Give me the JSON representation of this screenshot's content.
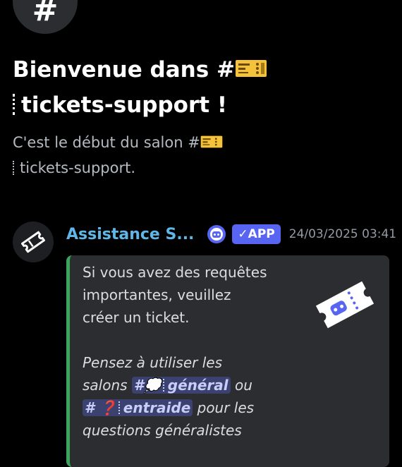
{
  "channel": {
    "hash_symbol": "#",
    "welcome_prefix": "Bienvenue dans #",
    "channel_name": "tickets-support",
    "welcome_suffix": " !",
    "subtitle_prefix": "C'est le début du salon #",
    "subtitle_suffix": "."
  },
  "message": {
    "author": "Assistance S...",
    "badge": "APP",
    "badge_check": "✓",
    "timestamp": "24/03/2025 03:41",
    "embed": {
      "accent_color": "#3ba55c",
      "line1": "Si vous avez des requêtes",
      "line2": "importantes, veuillez",
      "line3": "créer un ticket.",
      "line4": "Pensez à utiliser les",
      "line5_prefix": "salons ",
      "mention1_hash": "#",
      "mention1_emoji": "💭",
      "mention1_name": "général",
      "line5_suffix": " ou",
      "mention2_hash": "#",
      "mention2_emoji": "❓",
      "mention2_name": "entraide",
      "line6_suffix": " pour les",
      "line7": "questions généralistes"
    }
  },
  "colors": {
    "background": "#000000",
    "author": "#5fb7e8",
    "badge": "#5865f2",
    "mention_bg": "#3c4270",
    "embed_bg": "#2b2d31"
  }
}
